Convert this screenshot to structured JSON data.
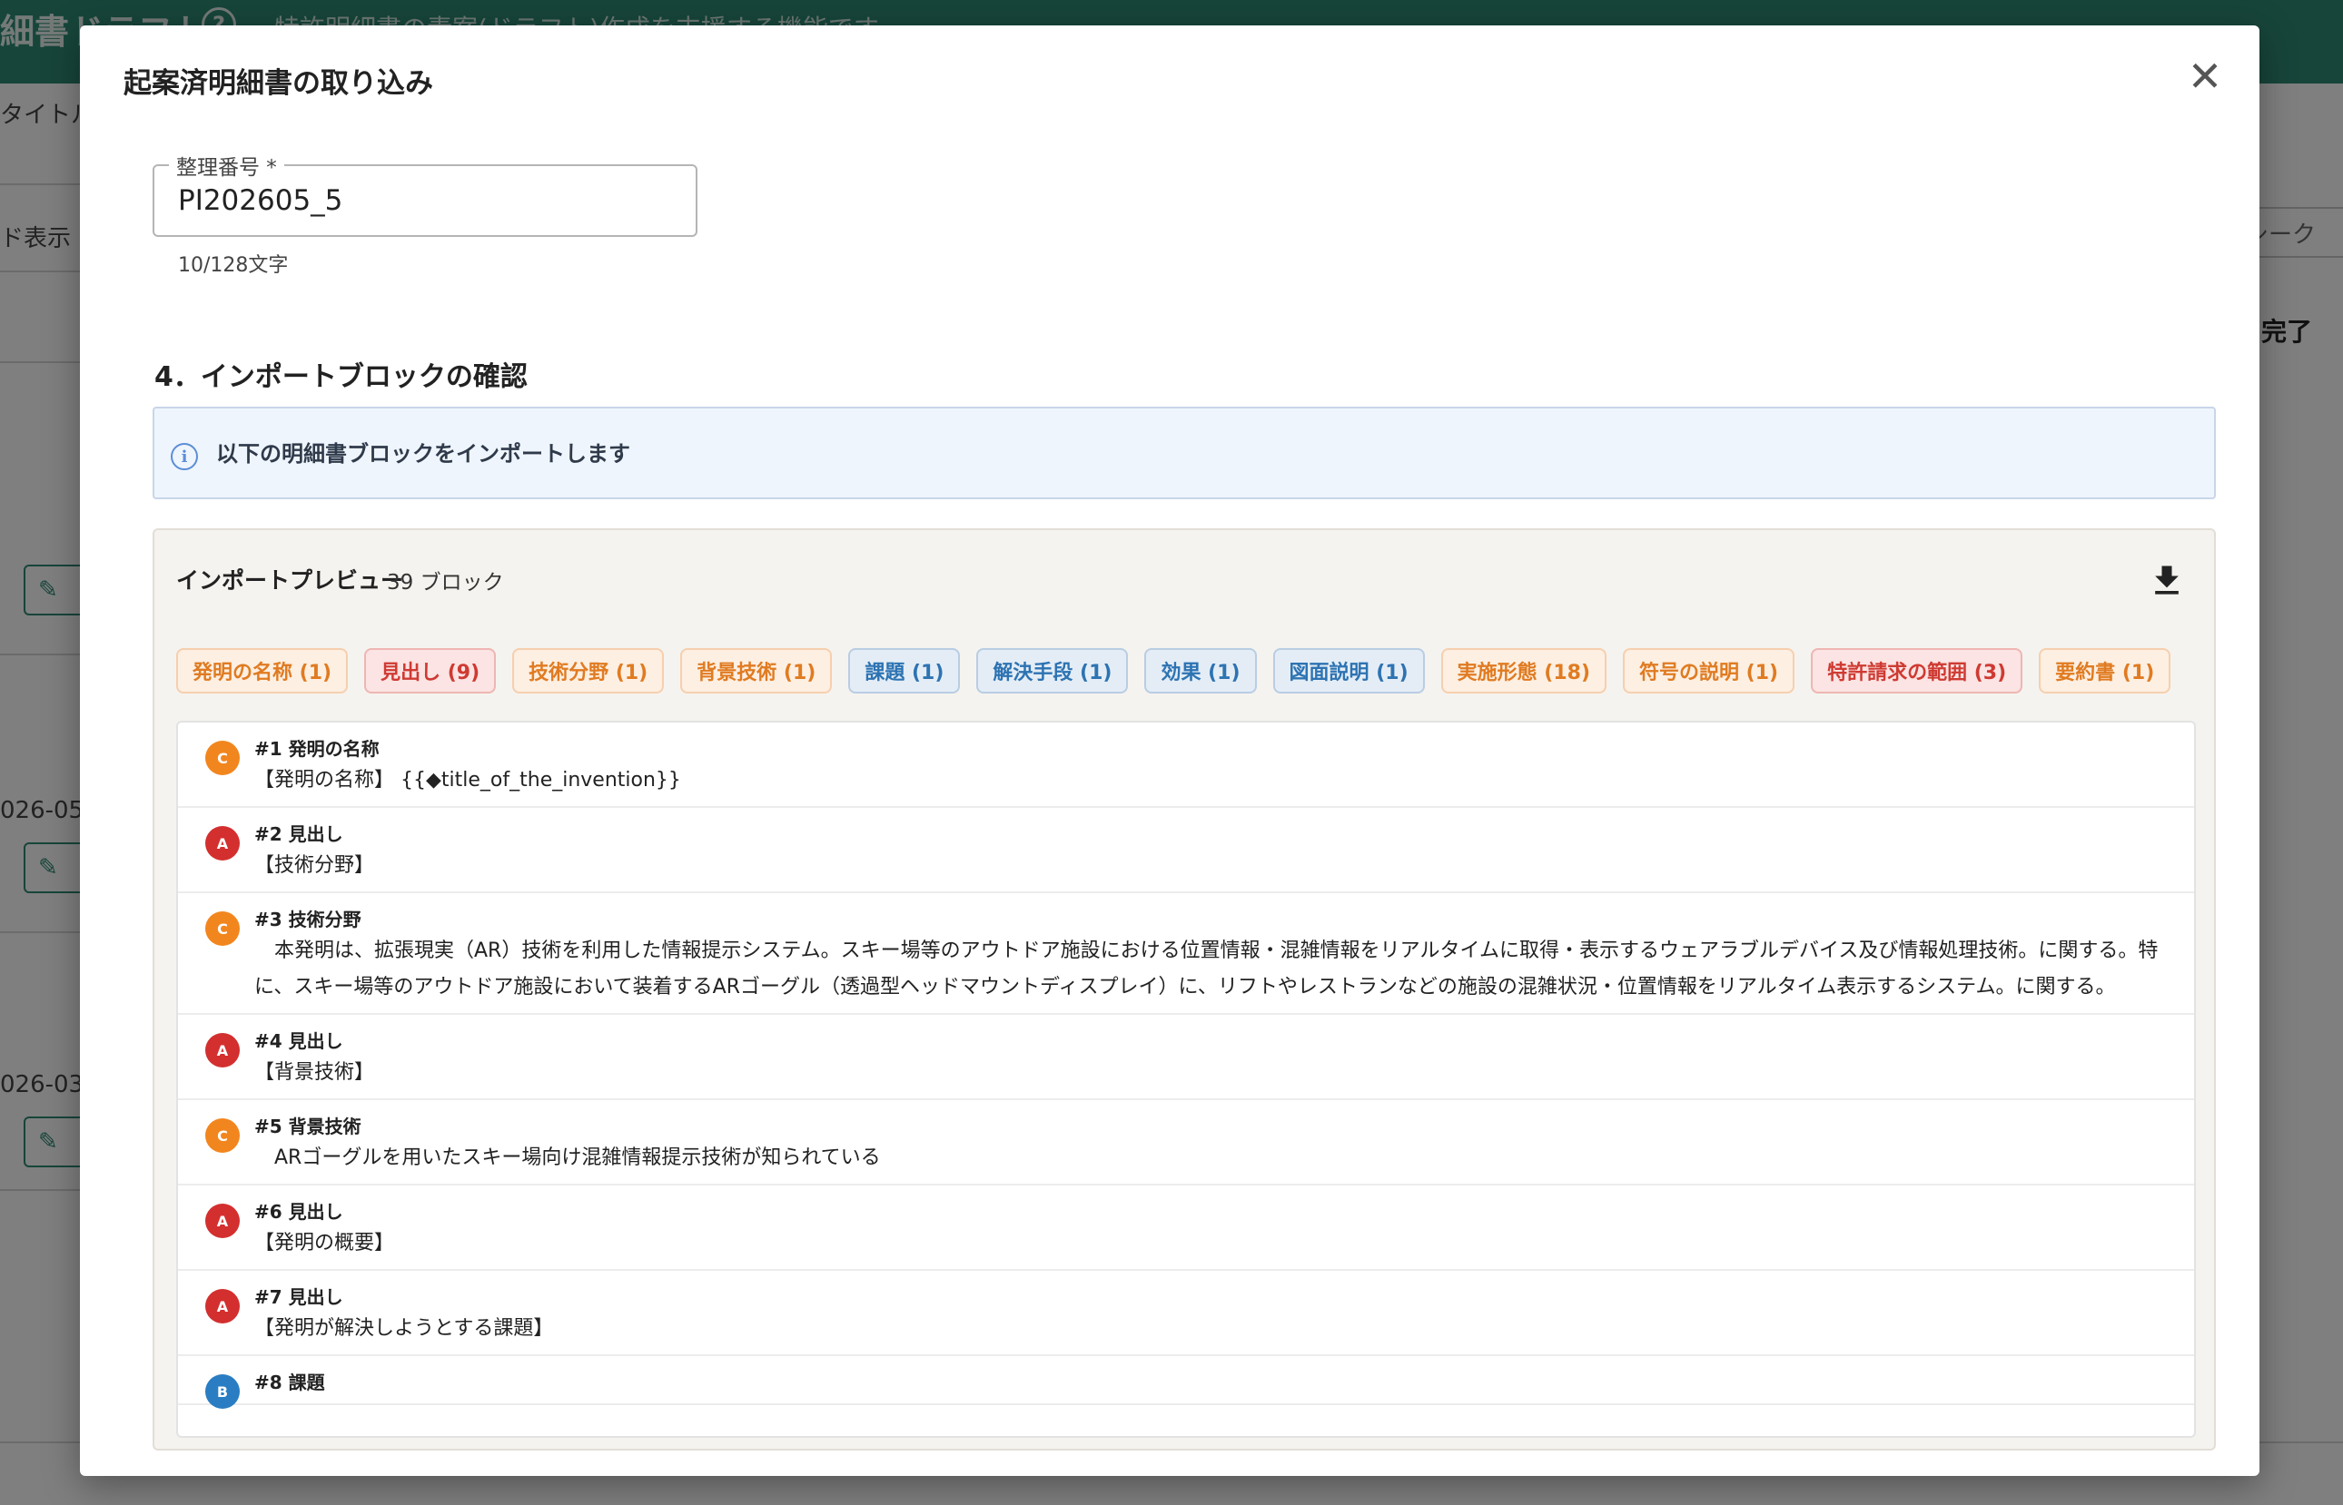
{
  "background": {
    "app_title": "細書ドラフト",
    "help_icon": "?",
    "description": "特許明細書の素案(ドラフト)作成を支援する機能です",
    "title_label": "タイトル",
    "mode_label": "ド表示",
    "search_label": "シーク",
    "done_label": "完了",
    "date1": "026-05-",
    "date2": "026-03-"
  },
  "modal": {
    "title": "起案済明細書の取り込み",
    "close_icon": "close-icon",
    "field": {
      "label": "整理番号 *",
      "value": "PI202605_5",
      "counter": "10/128文字"
    },
    "section_title": "4．インポートブロックの確認",
    "info": {
      "icon": "info-icon",
      "text": "以下の明細書ブロックをインポートします"
    },
    "preview": {
      "title": "インポートプレビュー",
      "count": "39 ブロック",
      "download_icon": "download-icon",
      "chips": [
        {
          "label": "発明の名称 (1)",
          "kind": "c"
        },
        {
          "label": "見出し (9)",
          "kind": "a"
        },
        {
          "label": "技術分野 (1)",
          "kind": "c"
        },
        {
          "label": "背景技術 (1)",
          "kind": "c"
        },
        {
          "label": "課題 (1)",
          "kind": "b"
        },
        {
          "label": "解決手段 (1)",
          "kind": "b"
        },
        {
          "label": "効果 (1)",
          "kind": "b"
        },
        {
          "label": "図面説明 (1)",
          "kind": "b"
        },
        {
          "label": "実施形態 (18)",
          "kind": "c"
        },
        {
          "label": "符号の説明 (1)",
          "kind": "c"
        },
        {
          "label": "特許請求の範囲 (3)",
          "kind": "a"
        },
        {
          "label": "要約書 (1)",
          "kind": "c"
        }
      ],
      "rows": [
        {
          "badge": "C",
          "kind": "c",
          "head": "#1 発明の名称",
          "body": "【発明の名称】 {{◆title_of_the_invention}}"
        },
        {
          "badge": "A",
          "kind": "a",
          "head": "#2 見出し",
          "body": "【技術分野】"
        },
        {
          "badge": "C",
          "kind": "c",
          "head": "#3 技術分野",
          "body": "　本発明は、拡張現実（AR）技術を利用した情報提示システム。スキー場等のアウトドア施設における位置情報・混雑情報をリアルタイムに取得・表示するウェアラブルデバイス及び情報処理技術。に関する。特に、スキー場等のアウトドア施設において装着するARゴーグル（透過型ヘッドマウントディスプレイ）に、リフトやレストランなどの施設の混雑状況・位置情報をリアルタイム表示するシステム。に関する。"
        },
        {
          "badge": "A",
          "kind": "a",
          "head": "#4 見出し",
          "body": "【背景技術】"
        },
        {
          "badge": "C",
          "kind": "c",
          "head": "#5 背景技術",
          "body": "　ARゴーグルを用いたスキー場向け混雑情報提示技術が知られている"
        },
        {
          "badge": "A",
          "kind": "a",
          "head": "#6 見出し",
          "body": "【発明の概要】"
        },
        {
          "badge": "A",
          "kind": "a",
          "head": "#7 見出し",
          "body": "【発明が解決しようとする課題】"
        },
        {
          "badge": "B",
          "kind": "b",
          "head": "#8 課題",
          "body": ""
        }
      ]
    }
  }
}
